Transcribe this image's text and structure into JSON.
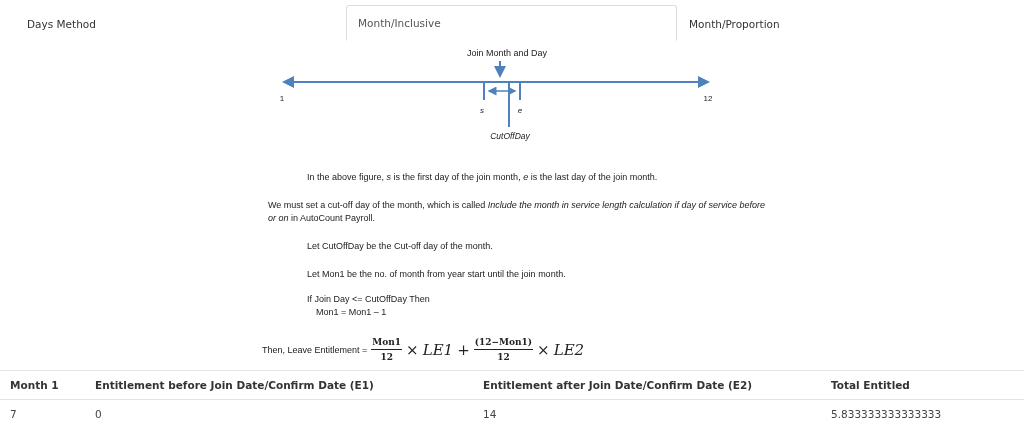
{
  "tabs": [
    {
      "label": "Days Method",
      "selected": false
    },
    {
      "label": "Month/Inclusive",
      "selected": true
    },
    {
      "label": "Month/Proportion",
      "selected": false
    }
  ],
  "diagram": {
    "top_label": "Join Month and Day",
    "start_label": "1",
    "end_label": "12",
    "s_label": "s",
    "e_label": "e",
    "cutoff_label": "CutOffDay"
  },
  "paragraphs": [
    {
      "kind": "indented",
      "text": "In the above figure, *s* is the first day of the join month, *e* is the last day of the join month."
    },
    {
      "kind": "plain",
      "text": "We must set a cut-off day of the month, which is called *Include the month in service length calculation if day of service before or on* in AutoCount Payroll."
    },
    {
      "kind": "indented",
      "text": "Let CutOffDay be the Cut-off day of the month."
    },
    {
      "kind": "indented",
      "text": "Let Mon1 be the no. of month from year start until the join month."
    }
  ],
  "code_lines": [
    "If Join Day <= CutOffDay Then",
    "Mon1 = Mon1 – 1"
  ],
  "formula": {
    "lead": "Then, Leave Entitlement =",
    "terms": [
      {
        "numerator": "Mon1",
        "denominator": "12",
        "times": "×",
        "factor": "LE1"
      },
      {
        "operator": "+",
        "numerator": "(12−Mon1)",
        "denominator": "12",
        "times": "×",
        "factor": "LE2"
      }
    ]
  },
  "table": {
    "columns": [
      "Month 1",
      "Entitlement before Join Date/Confirm Date (E1)",
      "Entitlement after Join Date/Confirm Date (E2)",
      "Total Entitled"
    ],
    "rows": [
      [
        "7",
        "0",
        "14",
        "5.833333333333333"
      ]
    ]
  }
}
